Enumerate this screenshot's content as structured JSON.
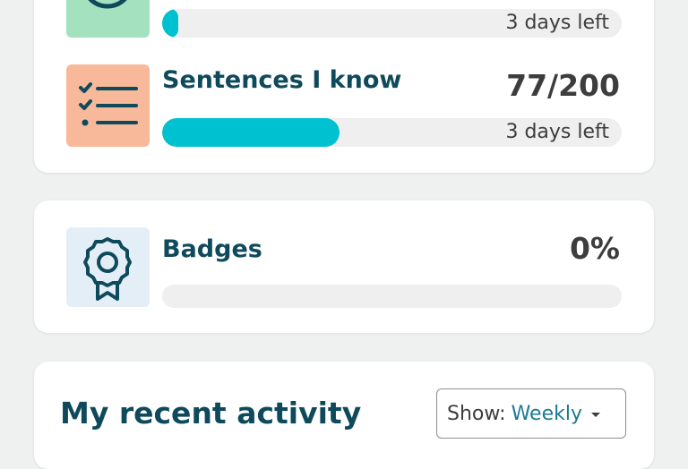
{
  "goals": [
    {
      "id": "time",
      "icon": "clock-icon",
      "title": "",
      "value": "",
      "progress": 0.03,
      "days_left": "3 days left",
      "icon_bg": "#a4e2bf"
    },
    {
      "id": "sentences",
      "icon": "checklist-icon",
      "title": "Sentences I know",
      "value": "77/200",
      "progress": 0.385,
      "days_left": "3 days left",
      "icon_bg": "#f8b99a"
    }
  ],
  "badges": {
    "icon": "badge-ribbon-icon",
    "title": "Badges",
    "value": "0%",
    "progress": 0,
    "icon_bg": "#e4eef6"
  },
  "activity": {
    "title": "My recent activity",
    "filter_label": "Show:",
    "filter_value": "Weekly"
  },
  "colors": {
    "accent": "#00c1cf",
    "heading": "#0f4a5c",
    "track": "#eeefee"
  }
}
